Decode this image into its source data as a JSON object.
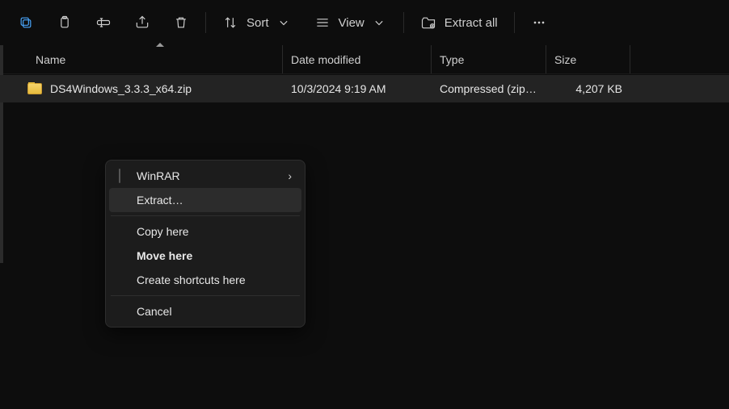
{
  "toolbar": {
    "sort_label": "Sort",
    "view_label": "View",
    "extract_all_label": "Extract all"
  },
  "columns": {
    "name": "Name",
    "date": "Date modified",
    "type": "Type",
    "size": "Size"
  },
  "files": [
    {
      "icon": "zip-folder-icon",
      "name": "DS4Windows_3.3.3_x64.zip",
      "date": "10/3/2024 9:19 AM",
      "type": "Compressed (zipp…",
      "size": "4,207 KB"
    }
  ],
  "context_menu": {
    "winrar_label": "WinRAR",
    "extract_label": "Extract…",
    "copy_here_label": "Copy here",
    "move_here_label": "Move here",
    "create_shortcuts_label": "Create shortcuts here",
    "cancel_label": "Cancel"
  }
}
